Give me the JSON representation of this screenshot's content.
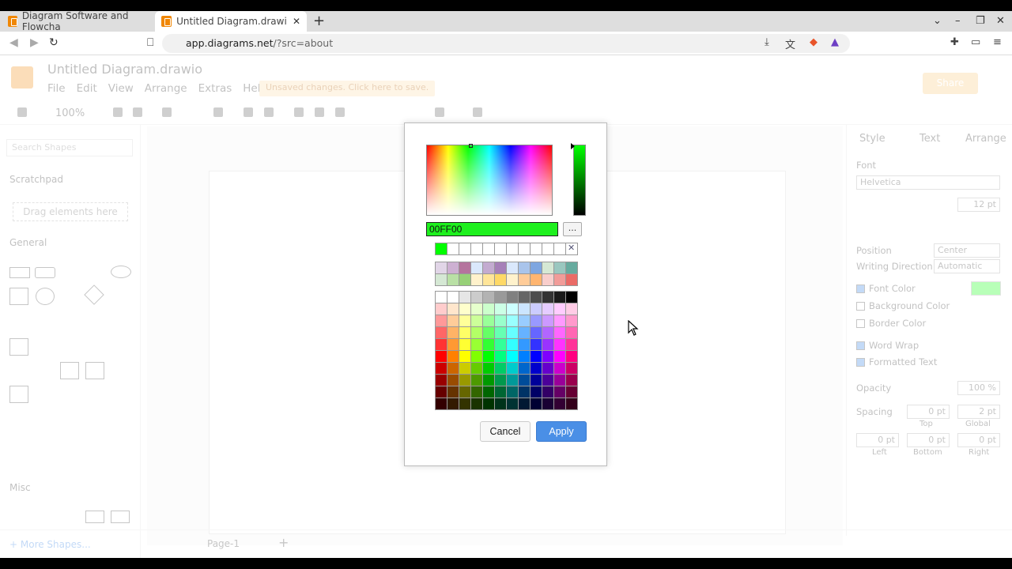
{
  "browser": {
    "tabs": [
      {
        "title": "Diagram Software and Flowcha"
      },
      {
        "title": "Untitled Diagram.drawio - d"
      }
    ],
    "url_host": "app.diagrams.net",
    "url_path": "/?src=about"
  },
  "app": {
    "title": "Untitled Diagram.drawio",
    "menu": [
      "File",
      "Edit",
      "View",
      "Arrange",
      "Extras",
      "Help"
    ],
    "unsaved": "Unsaved changes. Click here to save.",
    "share": "Share",
    "zoom": "100%",
    "search_placeholder": "Search Shapes",
    "scratchpad": "Scratchpad",
    "drop_text": "Drag elements here",
    "general": "General",
    "misc": "Misc",
    "more_shapes": "+ More Shapes...",
    "page_tab": "Page-1",
    "right_tabs": [
      "Style",
      "Text",
      "Arrange"
    ],
    "font_label": "Font",
    "font_value": "Helvetica",
    "font_size": "12 pt",
    "position_label": "Position",
    "position_value": "Center",
    "writing_label": "Writing Direction",
    "writing_value": "Automatic",
    "font_color": "Font Color",
    "background_color": "Background Color",
    "border_color": "Border Color",
    "word_wrap": "Word Wrap",
    "formatted_text": "Formatted Text",
    "opacity_label": "Opacity",
    "opacity_value": "100 %",
    "spacing_label": "Spacing",
    "spacing_top": "0 pt",
    "spacing_global": "2 pt",
    "spacing_left": "0 pt",
    "spacing_bottom": "0 pt",
    "spacing_right": "0 pt",
    "sp_top": "Top",
    "sp_global": "Global",
    "sp_left": "Left",
    "sp_bottom": "Bottom",
    "sp_right": "Right"
  },
  "dialog": {
    "hex_value": "00FF00",
    "more_label": "...",
    "cancel": "Cancel",
    "apply": "Apply",
    "recent_colors": [
      "#00ff00",
      "#ffffff",
      "#ffffff",
      "#ffffff",
      "#ffffff",
      "#ffffff",
      "#ffffff",
      "#ffffff",
      "#ffffff",
      "#ffffff",
      "#ffffff",
      "none"
    ],
    "preset_colors": [
      "#e1d5e7",
      "#cdb0d2",
      "#b5739d",
      "#dae8fc",
      "#c3abd0",
      "#a680b8",
      "#dae8fc",
      "#a9c4eb",
      "#7ea6e0",
      "#d5e8d4",
      "#9ac7bf",
      "#67ab9f",
      "#d5e8d4",
      "#b9e0a5",
      "#97d077",
      "#fff2cc",
      "#ffe599",
      "#ffd966",
      "#fff2cc",
      "#ffcc99",
      "#ffb570",
      "#f8cecc",
      "#f19c99",
      "#ea6b66"
    ],
    "grid_colors": [
      [
        "#ffffff",
        "#ffffff",
        "#e6e6e6",
        "#cccccc",
        "#b3b3b3",
        "#999999",
        "#808080",
        "#666666",
        "#4d4d4d",
        "#333333",
        "#1a1a1a",
        "#000000"
      ],
      [
        "#ffcccc",
        "#ffe6cc",
        "#ffffcc",
        "#e6ffcc",
        "#ccffcc",
        "#ccffe6",
        "#ccffff",
        "#cce5ff",
        "#ccccff",
        "#e5ccff",
        "#ffccff",
        "#ffcce6"
      ],
      [
        "#ff9999",
        "#ffcc99",
        "#ffff99",
        "#ccff99",
        "#99ff99",
        "#99ffcc",
        "#99ffff",
        "#99ccff",
        "#9999ff",
        "#cc99ff",
        "#ff99ff",
        "#ff99cc"
      ],
      [
        "#ff6666",
        "#ffb366",
        "#ffff66",
        "#b3ff66",
        "#66ff66",
        "#66ffb3",
        "#66ffff",
        "#66b2ff",
        "#6666ff",
        "#b266ff",
        "#ff66ff",
        "#ff66b3"
      ],
      [
        "#ff3333",
        "#ff9933",
        "#ffff33",
        "#99ff33",
        "#33ff33",
        "#33ff99",
        "#33ffff",
        "#3399ff",
        "#3333ff",
        "#9933ff",
        "#ff33ff",
        "#ff3399"
      ],
      [
        "#ff0000",
        "#ff8000",
        "#ffff00",
        "#80ff00",
        "#00ff00",
        "#00ff80",
        "#00ffff",
        "#007fff",
        "#0000ff",
        "#7f00ff",
        "#ff00ff",
        "#ff0080"
      ],
      [
        "#cc0000",
        "#cc6600",
        "#cccc00",
        "#66cc00",
        "#00cc00",
        "#00cc66",
        "#00cccc",
        "#0066cc",
        "#0000cc",
        "#6600cc",
        "#cc00cc",
        "#cc0066"
      ],
      [
        "#990000",
        "#994c00",
        "#999900",
        "#4d9900",
        "#009900",
        "#00994d",
        "#009999",
        "#004c99",
        "#000099",
        "#4c0099",
        "#990099",
        "#99004d"
      ],
      [
        "#660000",
        "#663300",
        "#666600",
        "#336600",
        "#006600",
        "#006633",
        "#006666",
        "#003366",
        "#000066",
        "#330066",
        "#660066",
        "#660033"
      ],
      [
        "#330000",
        "#331a00",
        "#333300",
        "#1a3300",
        "#003300",
        "#00331a",
        "#003333",
        "#001933",
        "#000033",
        "#190033",
        "#330033",
        "#33001a"
      ]
    ]
  }
}
